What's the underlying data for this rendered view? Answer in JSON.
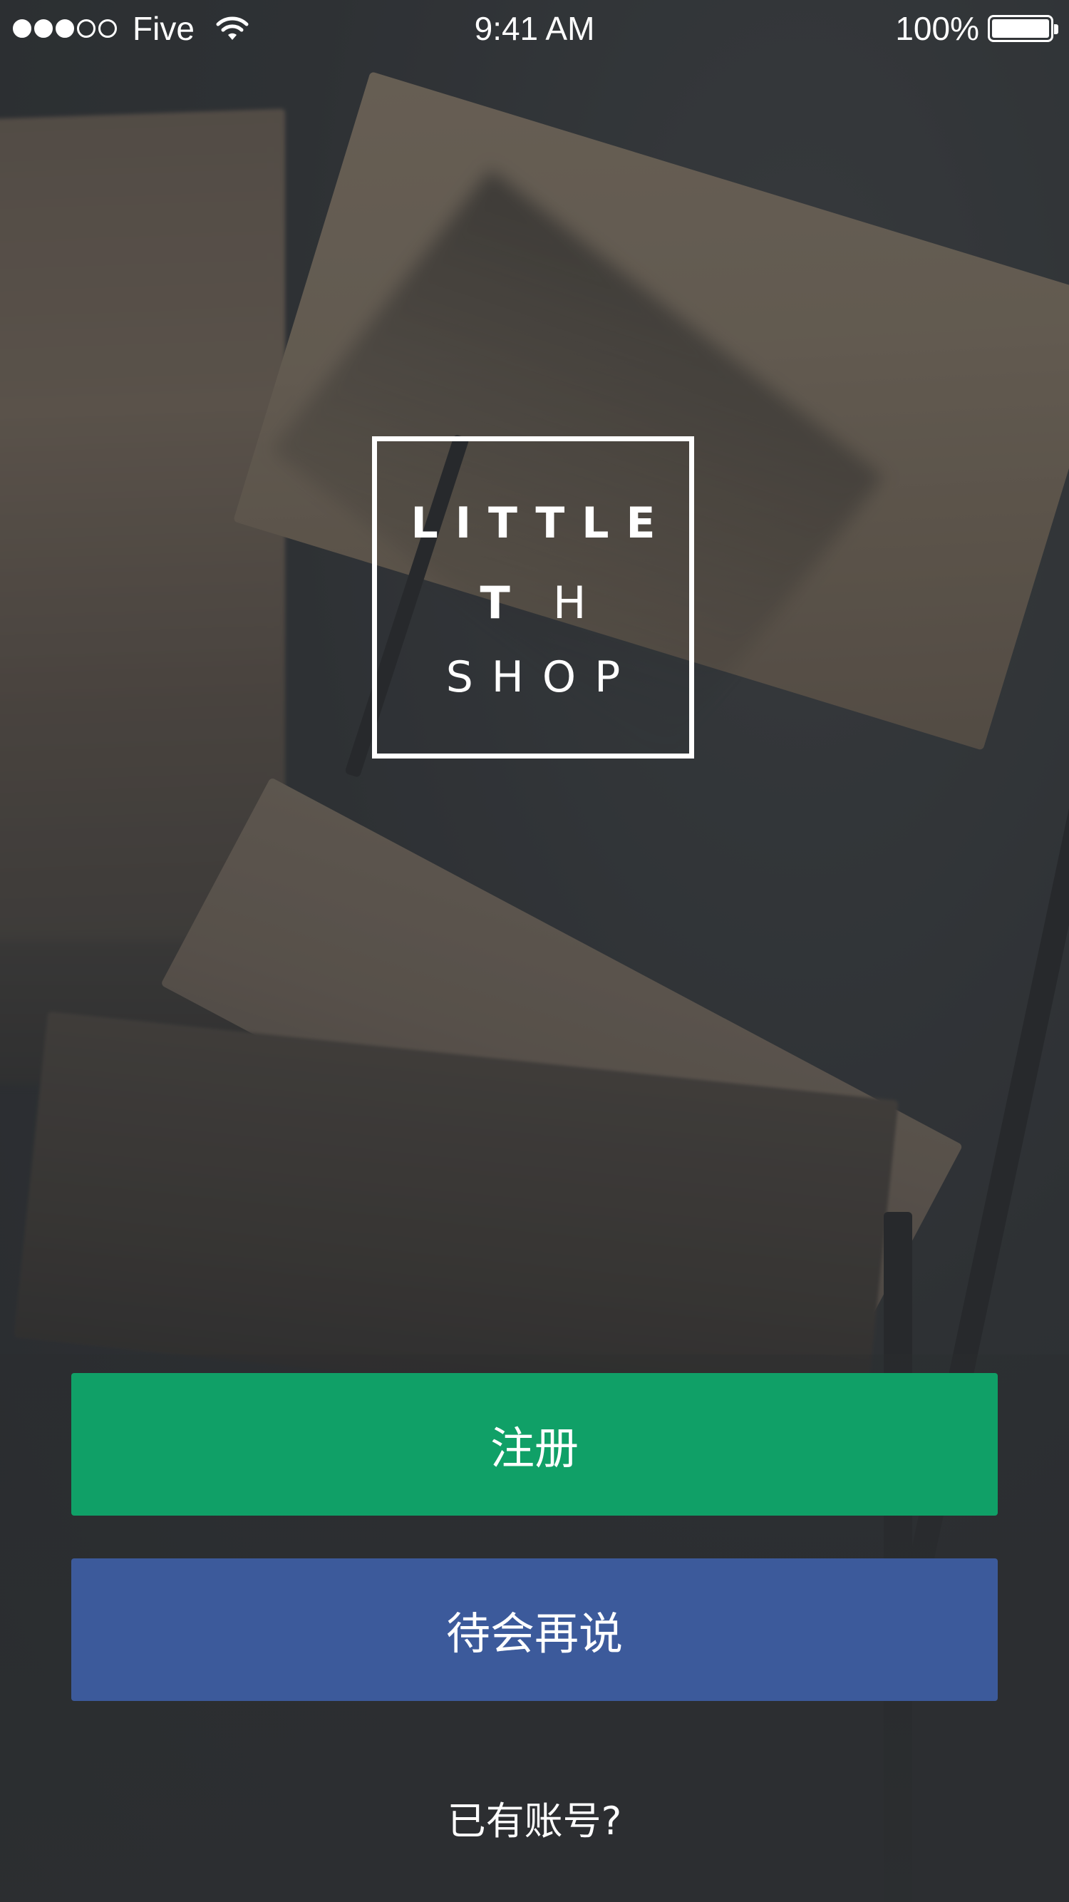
{
  "status_bar": {
    "signal_full": 3,
    "signal_total": 5,
    "carrier": "Five",
    "time": "9:41 AM",
    "battery_text": "100%"
  },
  "logo": {
    "line1": "LITTLE",
    "line2_bold": "T",
    "line2_light": "H",
    "line3": "SHOP"
  },
  "buttons": {
    "register": "注册",
    "later": "待会再说"
  },
  "login_link": "已有账号?",
  "colors": {
    "register": "#10a067",
    "later": "#3c5a9b"
  }
}
